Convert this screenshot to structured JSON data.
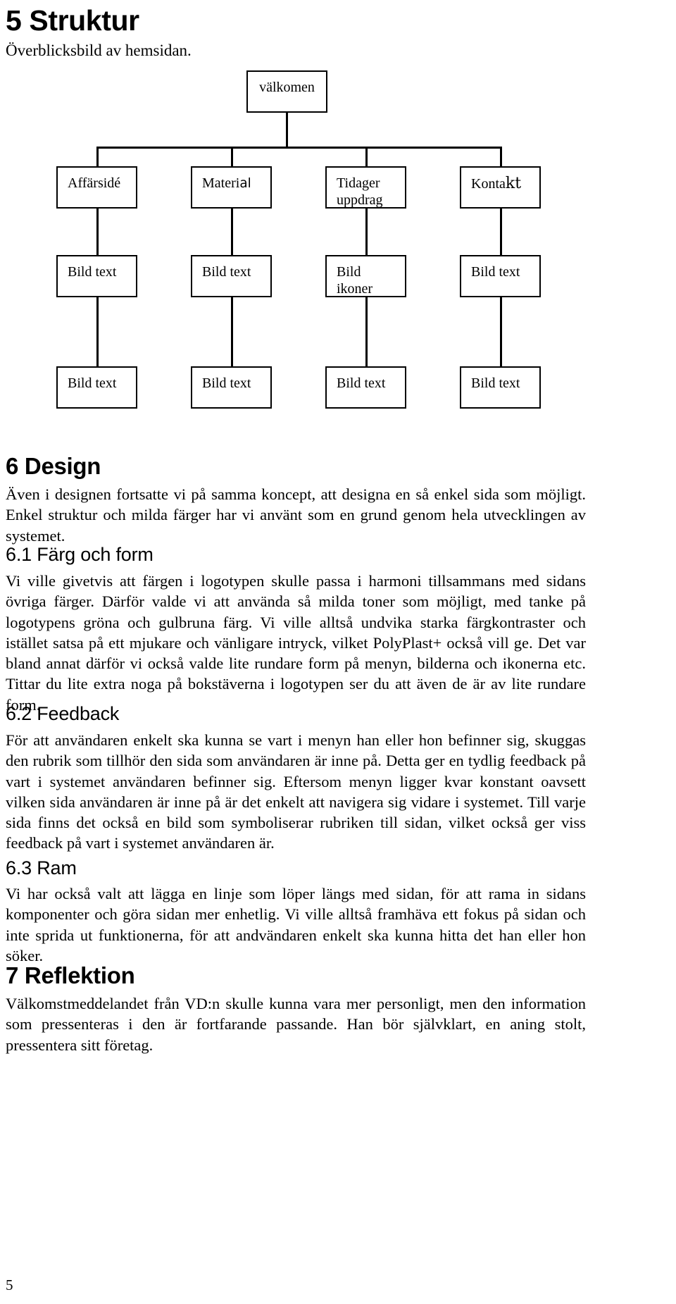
{
  "document": {
    "page_number": "5",
    "language": "sv"
  },
  "sections": {
    "struktur": {
      "heading": "5 Struktur",
      "subtitle": "Överblicksbild av hemsidan."
    },
    "design": {
      "heading": "6 Design",
      "paragraph": "Även i designen fortsatte vi på samma koncept, att designa en så enkel sida som möjligt. Enkel struktur och milda färger har vi använt som en grund genom hela utvecklingen av systemet."
    },
    "farg_och_form": {
      "heading": "6.1 Färg och form",
      "paragraph": "Vi ville givetvis att färgen i logotypen skulle passa i harmoni tillsammans med sidans övriga färger. Därför valde vi att använda så milda toner som möjligt, med tanke på logotypens gröna och gulbruna färg. Vi ville alltså undvika starka färgkontraster och istället satsa på ett mjukare och vänligare intryck, vilket PolyPlast+ också vill ge. Det var bland annat därför vi också valde lite rundare form på menyn, bilderna och ikonerna etc. Tittar du lite extra noga på bokstäverna i logotypen ser du att även de är av lite rundare form."
    },
    "feedback": {
      "heading": "6.2 Feedback",
      "paragraph": "För att användaren enkelt ska kunna se vart i menyn han eller hon befinner sig, skuggas den rubrik som tillhör den sida som användaren är inne på. Detta ger en tydlig feedback på vart i systemet användaren befinner sig. Eftersom menyn ligger kvar konstant oavsett vilken sida användaren är inne på är det enkelt att navigera sig vidare i systemet. Till varje sida finns det också en bild som symboliserar rubriken till sidan, vilket också ger viss feedback på vart i systemet användaren är."
    },
    "ram": {
      "heading": "6.3 Ram",
      "paragraph": "Vi har också valt att lägga en linje som löper längs med sidan, för att rama in sidans komponenter och göra sidan mer enhetlig. Vi ville alltså framhäva ett fokus på sidan och inte sprida ut funktionerna, för att andvändaren enkelt ska kunna hitta det han eller hon söker."
    },
    "reflektion": {
      "heading": "7 Reflektion",
      "paragraph": "Välkomstmeddelandet från VD:n skulle kunna vara mer personligt, men den information som pressenteras i den är fortfarande passande. Han bör självklart, en aning stolt, pressentera sitt företag."
    }
  },
  "sitemap": {
    "root": {
      "label": "välkomen"
    },
    "level2": [
      {
        "label": "Affärsidé"
      },
      {
        "label_part1": "Materi",
        "label_part2": "al"
      },
      {
        "line1": "Tidager",
        "line2": "uppdrag"
      },
      {
        "label_part1": "Konta",
        "label_part2": "kt"
      }
    ],
    "level3": [
      {
        "label": "Bild  text"
      },
      {
        "label": "Bild  text"
      },
      {
        "line1": "Bild",
        "line2": "ikoner"
      },
      {
        "label": "Bild  text"
      }
    ],
    "level4": [
      {
        "label": "Bild  text"
      },
      {
        "label": "Bild  text"
      },
      {
        "label": "Bild  text"
      },
      {
        "label": "Bild  text"
      }
    ]
  },
  "colors": {
    "text": "#000000",
    "box_border": "#000000",
    "background": "#ffffff"
  }
}
